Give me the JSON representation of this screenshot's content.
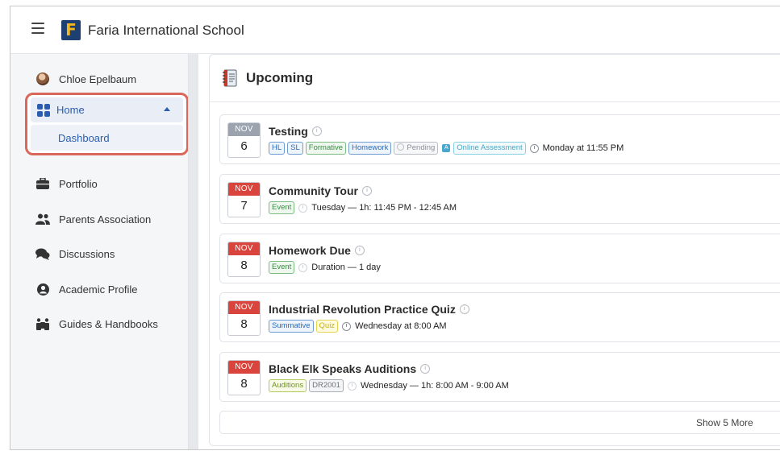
{
  "header": {
    "app_title": "Faria International School",
    "logo_letter": "F"
  },
  "sidebar": {
    "user_name": "Chloe Epelbaum",
    "home_label": "Home",
    "dashboard_label": "Dashboard",
    "items": [
      {
        "label": "Portfolio",
        "icon": "briefcase-icon"
      },
      {
        "label": "Parents Association",
        "icon": "users-icon"
      },
      {
        "label": "Discussions",
        "icon": "chat-bubbles-icon"
      },
      {
        "label": "Academic Profile",
        "icon": "user-circle-icon"
      },
      {
        "label": "Guides & Handbooks",
        "icon": "guides-icon"
      }
    ]
  },
  "main": {
    "title": "Upcoming",
    "events": [
      {
        "month": "NOV",
        "day": "6",
        "title": "Testing",
        "tags": [
          "HL",
          "SL",
          "Formative",
          "Homework"
        ],
        "status": "Pending",
        "assessment": "Online Assessment",
        "time": "Monday at 11:55 PM"
      },
      {
        "month": "NOV",
        "day": "7",
        "title": "Community Tour",
        "tags": [
          "Event"
        ],
        "time": "Tuesday — 1h: 11:45 PM - 12:45 AM"
      },
      {
        "month": "NOV",
        "day": "8",
        "title": "Homework Due",
        "tags": [
          "Event"
        ],
        "time": "Duration — 1 day"
      },
      {
        "month": "NOV",
        "day": "8",
        "title": "Industrial Revolution Practice Quiz",
        "tags": [
          "Summative",
          "Quiz"
        ],
        "time": "Wednesday at 8:00 AM"
      },
      {
        "month": "NOV",
        "day": "8",
        "title": "Black Elk Speaks Auditions",
        "tags": [
          "Auditions",
          "DR2001"
        ],
        "time": "Wednesday — 1h: 8:00 AM - 9:00 AM"
      }
    ],
    "show_more_label": "Show 5 More"
  },
  "colors": {
    "brand_navy": "#1d3f72",
    "brand_gold": "#f2b51c",
    "highlight_red": "#d9685a",
    "date_red": "#d9453d",
    "link_blue": "#2a5db0"
  }
}
